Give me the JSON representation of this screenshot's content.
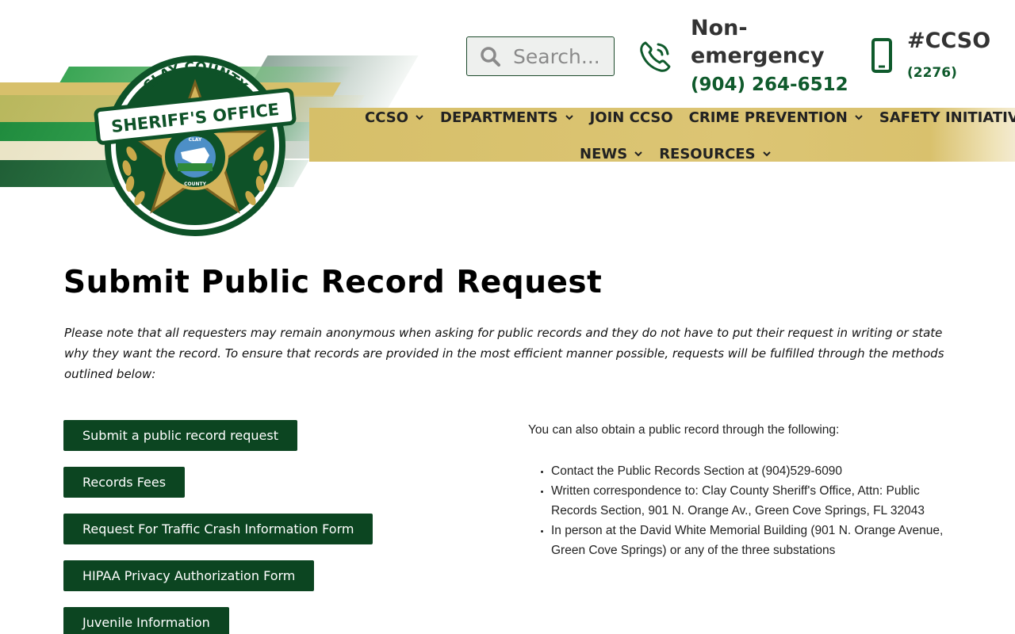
{
  "search": {
    "placeholder": "Search..."
  },
  "contact": {
    "nonemergency_label": "Non-emergency",
    "nonemergency_number": "(904) 264-6512",
    "hashtag_label": "#CCSO",
    "hashtag_number": "(2276)"
  },
  "logo": {
    "top_text": "CLAY COUNTY",
    "banner_text": "SHERIFF'S OFFICE",
    "inner_text": "SHERIFF'S OFFICE",
    "county_top": "CLAY",
    "county_bottom": "COUNTY"
  },
  "nav": {
    "items": [
      {
        "label": "CCSO",
        "dropdown": true
      },
      {
        "label": "DEPARTMENTS",
        "dropdown": true
      },
      {
        "label": "JOIN CCSO",
        "dropdown": false
      },
      {
        "label": "CRIME PREVENTION",
        "dropdown": true
      },
      {
        "label": "SAFETY INITIATIVES",
        "dropdown": true
      },
      {
        "label": "NEWS",
        "dropdown": true
      },
      {
        "label": "RESOURCES",
        "dropdown": true
      }
    ]
  },
  "main": {
    "title": "Submit Public Record Request",
    "intro": "Please note that all requesters may remain anonymous when asking for public records and they do not have to put their request in writing or state why they want the record. To ensure that records are provided in the most efficient manner possible, requests will be fulfilled through the methods outlined below:",
    "buttons": [
      "Submit a public record request",
      "Records Fees",
      "Request For Traffic Crash Information Form",
      "HIPAA Privacy Authorization Form",
      "Juvenile Information"
    ],
    "right_intro": "You can also obtain a public record through the following:",
    "right_list": [
      "Contact the Public Records Section at (904)529-6090",
      "Written correspondence to: Clay County Sheriff's Office, Attn: Public Records Section, 901 N. Orange Av., Green Cove Springs, FL 32043",
      "In person at the David White Memorial Building (901 N. Orange Avenue, Green Cove Springs) or any of the three substations"
    ]
  },
  "colors": {
    "brand_green": "#0c4521",
    "accent_green": "#0f5a2c",
    "gold": "#d6bf69"
  }
}
